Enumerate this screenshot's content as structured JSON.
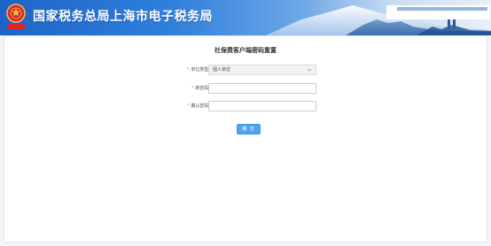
{
  "header": {
    "site_title": "国家税务总局上海市电子税务局",
    "emblem_text": "中国税务"
  },
  "form": {
    "title": "社保费客户端密码重置",
    "fields": [
      {
        "label": "单位类型:",
        "required_mark": "*",
        "value": "個人单位",
        "type": "select"
      },
      {
        "label": "新密码:",
        "required_mark": "*",
        "value": "",
        "type": "password"
      },
      {
        "label": "确认密码:",
        "required_mark": "*",
        "value": "",
        "type": "password"
      }
    ],
    "submit_label": "确 定"
  },
  "colors": {
    "header_blue": "#1e64c8",
    "accent_button": "#4fa3f0",
    "required_star": "#f08a1a"
  },
  "icons": {
    "emblem": "tax-emblem-icon",
    "dropdown": "chevron-down-icon"
  }
}
